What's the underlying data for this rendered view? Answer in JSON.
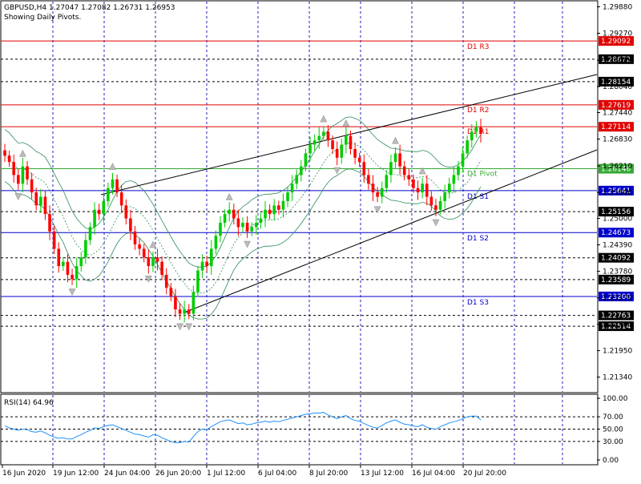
{
  "header": {
    "symbol_line": "GBPUSD,H4  1.27047 1.27082 1.26731 1.26953",
    "subtitle": "Showing Daily Pivots."
  },
  "chart_data": {
    "type": "candlestick",
    "symbol": "GBPUSD",
    "timeframe": "H4",
    "ohlc_last": {
      "open": 1.27047,
      "high": 1.27082,
      "low": 1.26731,
      "close": 1.26953
    },
    "ylim": [
      1.21,
      1.3
    ],
    "y_ticks": [
      "1.29880",
      "1.29270",
      "1.28650",
      "1.28040",
      "1.27440",
      "1.26830",
      "1.26210",
      "1.25600",
      "1.25000",
      "1.24390",
      "1.23780",
      "1.23170",
      "1.22560",
      "1.21950",
      "1.21340"
    ],
    "x_ticks": [
      "16 Jun 2020",
      "19 Jun 12:00",
      "24 Jun 04:00",
      "26 Jun 20:00",
      "1 Jul 12:00",
      "6 Jul 04:00",
      "8 Jul 20:00",
      "13 Jul 12:00",
      "16 Jul 04:00",
      "20 Jul 20:00"
    ],
    "pivots": [
      {
        "label": "D1 R3",
        "value": 1.29092,
        "color": "#e00000"
      },
      {
        "label": "D1 R2",
        "value": 1.27619,
        "color": "#e00000"
      },
      {
        "label": "D1 R1",
        "value": 1.27114,
        "color": "#e00000"
      },
      {
        "label": "D1 Pivot",
        "value": 1.26146,
        "color": "#33aa33"
      },
      {
        "label": "D1 S1",
        "value": 1.25641,
        "color": "#0000cc"
      },
      {
        "label": "D1 S2",
        "value": 1.24673,
        "color": "#0000cc"
      },
      {
        "label": "D1 S3",
        "value": 1.232,
        "color": "#0000cc"
      }
    ],
    "price_levels": [
      {
        "value": 1.28672,
        "style": "dashed"
      },
      {
        "value": 1.28154,
        "style": "dashed"
      },
      {
        "value": 1.25156,
        "style": "dashed"
      },
      {
        "value": 1.24092,
        "style": "dashed"
      },
      {
        "value": 1.23589,
        "style": "dashed"
      },
      {
        "value": 1.22763,
        "style": "dashed"
      },
      {
        "value": 1.22514,
        "style": "dashed"
      }
    ],
    "closes": [
      1.2645,
      1.263,
      1.26,
      1.258,
      1.262,
      1.259,
      1.256,
      1.253,
      1.255,
      1.251,
      1.247,
      1.243,
      1.239,
      1.24,
      1.237,
      1.236,
      1.239,
      1.241,
      1.245,
      1.248,
      1.252,
      1.251,
      1.254,
      1.257,
      1.259,
      1.256,
      1.253,
      1.25,
      1.247,
      1.244,
      1.243,
      1.241,
      1.239,
      1.241,
      1.24,
      1.237,
      1.234,
      1.232,
      1.229,
      1.228,
      1.229,
      1.228,
      1.233,
      1.238,
      1.24,
      1.239,
      1.243,
      1.246,
      1.249,
      1.251,
      1.252,
      1.25,
      1.248,
      1.249,
      1.247,
      1.248,
      1.249,
      1.25,
      1.252,
      1.251,
      1.253,
      1.252,
      1.254,
      1.256,
      1.258,
      1.26,
      1.262,
      1.265,
      1.267,
      1.268,
      1.269,
      1.27,
      1.268,
      1.266,
      1.264,
      1.267,
      1.269,
      1.266,
      1.264,
      1.263,
      1.26,
      1.258,
      1.256,
      1.255,
      1.257,
      1.26,
      1.263,
      1.265,
      1.262,
      1.26,
      1.259,
      1.257,
      1.256,
      1.258,
      1.255,
      1.253,
      1.252,
      1.254,
      1.256,
      1.258,
      1.26,
      1.262,
      1.265,
      1.268,
      1.27,
      1.271,
      1.2695
    ],
    "rsi": {
      "label": "RSI(14) 64.96",
      "period": 14,
      "last": 64.96,
      "ylim": [
        0,
        100
      ],
      "y_ticks": [
        "100.00",
        "70.00",
        "50.00",
        "30.00",
        "0.00"
      ],
      "levels": [
        70,
        50,
        30
      ],
      "values": [
        55,
        52,
        50,
        48,
        50,
        49,
        46,
        45,
        47,
        44,
        40,
        37,
        35,
        36,
        34,
        34,
        38,
        41,
        45,
        48,
        52,
        51,
        54,
        56,
        57,
        54,
        51,
        48,
        45,
        42,
        41,
        39,
        37,
        41,
        40,
        36,
        33,
        30,
        28,
        28,
        30,
        29,
        38,
        46,
        50,
        49,
        54,
        58,
        62,
        64,
        65,
        62,
        59,
        60,
        57,
        58,
        60,
        61,
        63,
        61,
        63,
        62,
        64,
        66,
        68,
        70,
        72,
        74,
        75,
        76,
        76,
        77,
        73,
        70,
        67,
        70,
        72,
        67,
        64,
        63,
        59,
        56,
        53,
        52,
        56,
        60,
        63,
        65,
        61,
        58,
        57,
        55,
        54,
        57,
        53,
        51,
        50,
        54,
        57,
        60,
        62,
        64,
        67,
        70,
        71,
        71,
        65
      ]
    }
  }
}
